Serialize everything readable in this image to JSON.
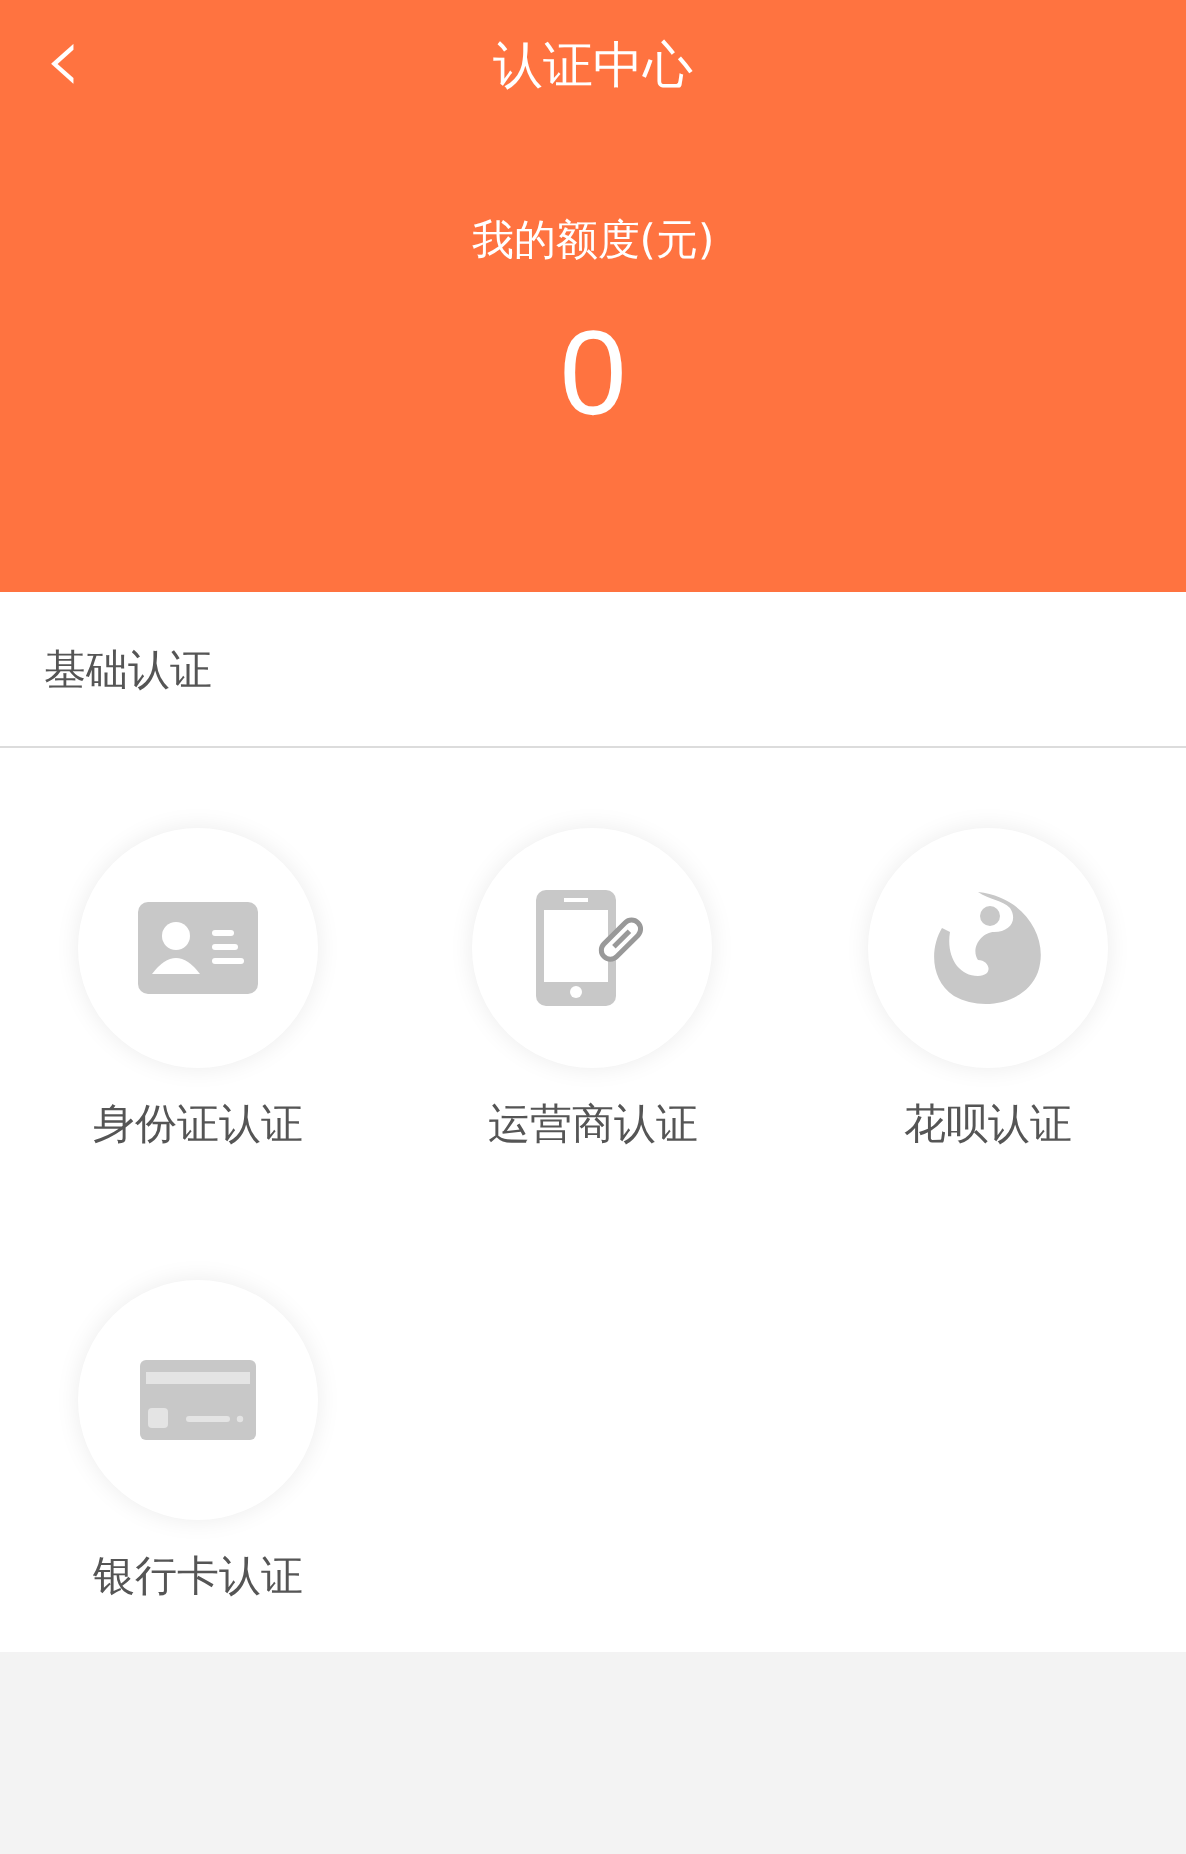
{
  "header": {
    "back": "‹",
    "title": "认证中心",
    "quota_label": "我的额度(元)",
    "quota_value": "0"
  },
  "section": {
    "title": "基础认证"
  },
  "items": [
    {
      "kind": "id",
      "label": "身份证认证"
    },
    {
      "kind": "phone",
      "label": "运营商认证"
    },
    {
      "kind": "huabei",
      "label": "花呗认证"
    },
    {
      "kind": "bank",
      "label": "银行卡认证"
    }
  ]
}
